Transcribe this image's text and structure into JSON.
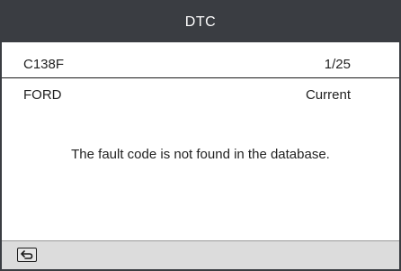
{
  "header": {
    "title": "DTC"
  },
  "code_row": {
    "code": "C138F",
    "position": "1/25"
  },
  "info_row": {
    "make": "FORD",
    "status": "Current"
  },
  "message": "The fault code is not found in the database.",
  "footer": {
    "back_icon": "return-arrow-icon"
  },
  "colors": {
    "titlebar": "#3a3d42",
    "footer": "#dcdcdc",
    "text": "#222222"
  }
}
